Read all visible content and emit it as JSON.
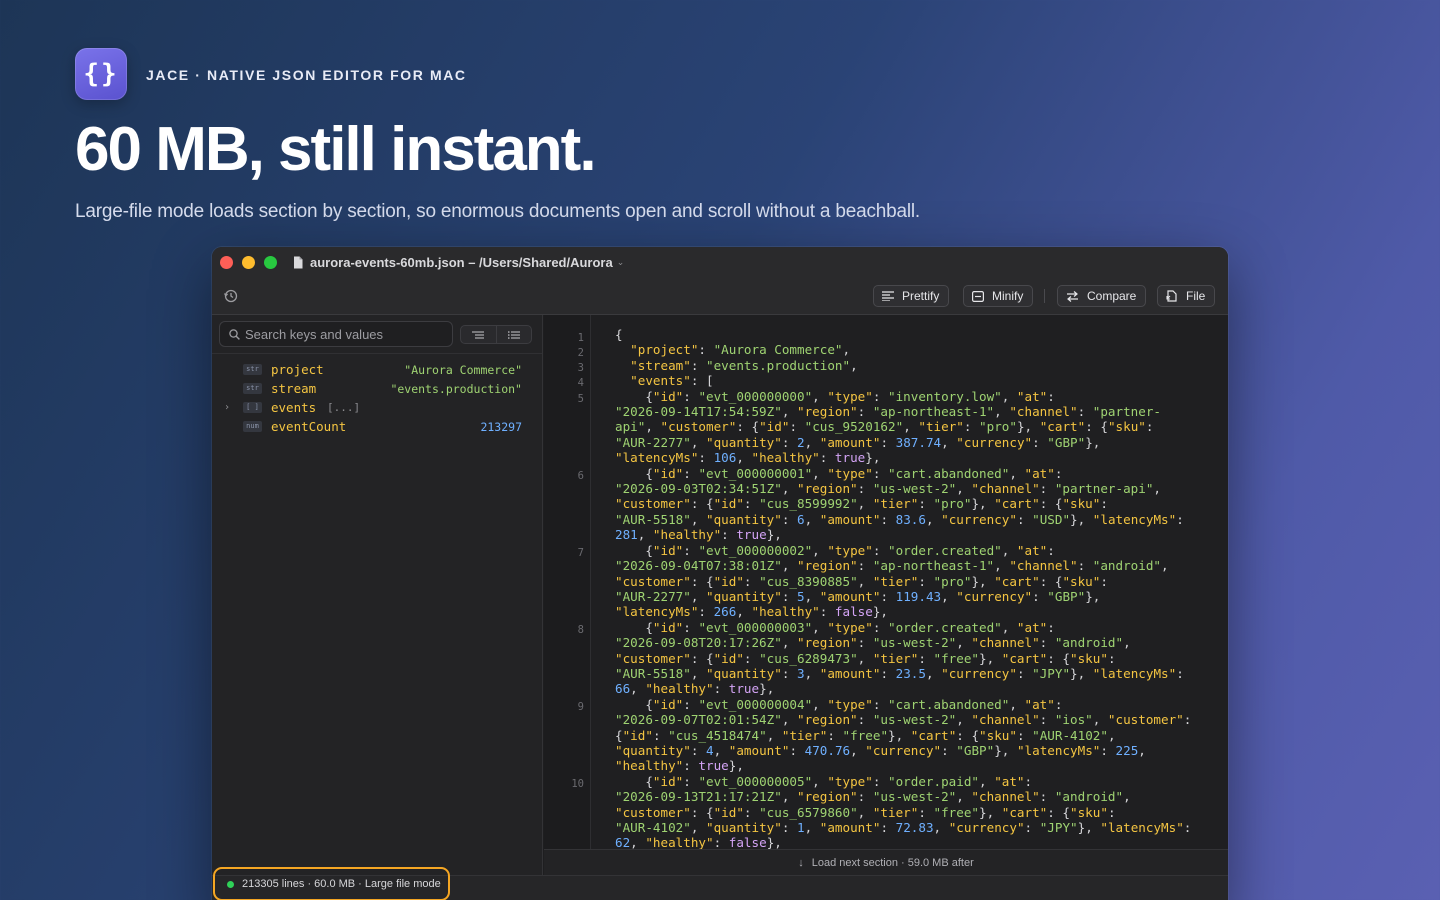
{
  "hero": {
    "logo_glyph": "{}",
    "eyebrow": "JACE · NATIVE JSON EDITOR FOR MAC",
    "title": "60 MB, still instant.",
    "subtitle": "Large-file mode loads section by section, so enormous documents open and scroll without a beachball."
  },
  "window": {
    "title": "aurora-events-60mb.json – /Users/Shared/Aurora"
  },
  "toolbar": {
    "prettify": "Prettify",
    "minify": "Minify",
    "compare": "Compare",
    "file": "File"
  },
  "sidebar": {
    "search_placeholder": "Search keys and values",
    "tree": [
      {
        "badge": "str",
        "key": "project",
        "value": "\"Aurora Commerce\"",
        "kind": "str"
      },
      {
        "badge": "str",
        "key": "stream",
        "value": "\"events.production\"",
        "kind": "str"
      },
      {
        "badge": "[ ]",
        "key": "events",
        "value": "[...]",
        "kind": "arr"
      },
      {
        "badge": "num",
        "key": "eventCount",
        "value": "213297",
        "kind": "num"
      }
    ]
  },
  "editor": {
    "line_numbers": [
      "1",
      "2",
      "3",
      "4",
      "5",
      "6",
      "7",
      "8",
      "9",
      "10"
    ],
    "load_next": "Load next section · 59.0 MB after"
  },
  "status": {
    "text": "213305 lines · 60.0 MB · Large file mode"
  },
  "colors": {
    "accent_orange": "#f5a623",
    "key_yellow": "#f4c542",
    "string_green": "#9fd372",
    "number_blue": "#6fb0ff",
    "status_green": "#2fd158"
  }
}
